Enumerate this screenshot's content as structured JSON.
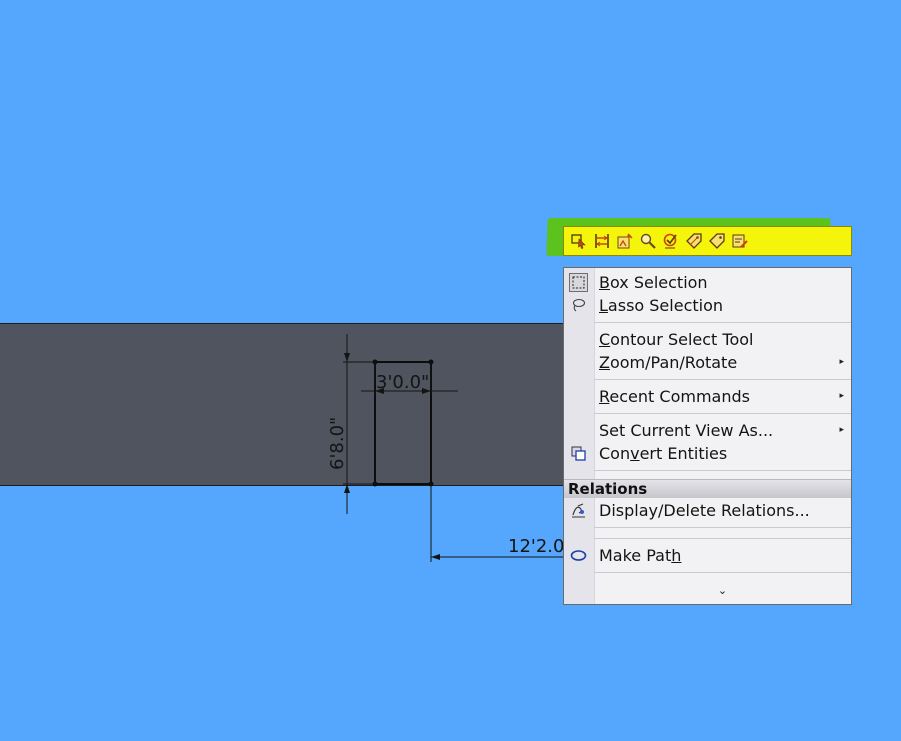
{
  "drawing": {
    "dim_width": "3'0.0\"",
    "dim_height": "6'8.0\"",
    "dim_offset": "12'2.0"
  },
  "toolbar": {
    "buttons": [
      {
        "icon": "select-icon"
      },
      {
        "icon": "trim-icon"
      },
      {
        "icon": "sketch-picture-icon"
      },
      {
        "icon": "zoom-icon"
      },
      {
        "icon": "relation-icon"
      },
      {
        "icon": "tag-icon"
      },
      {
        "icon": "tag-alt-icon"
      },
      {
        "icon": "edit-sketch-icon"
      }
    ],
    "highlight_color": "#5cc21e",
    "background_color": "#f5f50c"
  },
  "menu": {
    "items": {
      "box_selection": {
        "pre": "",
        "key": "B",
        "post": "ox Selection"
      },
      "lasso_selection": {
        "pre": "",
        "key": "L",
        "post": "asso Selection"
      },
      "contour_select": {
        "pre": "",
        "key": "C",
        "post": "ontour Select Tool"
      },
      "zoom_pan_rotate": {
        "pre": "",
        "key": "Z",
        "post": "oom/Pan/Rotate"
      },
      "recent_commands": {
        "pre": "",
        "key": "R",
        "post": "ecent Commands"
      },
      "set_view": {
        "label": "Set Current View As..."
      },
      "convert_entities": {
        "pre": "Con",
        "key": "v",
        "post": "ert Entities"
      },
      "display_relations": {
        "label": "Display/Delete Relations..."
      },
      "make_path": {
        "pre": "Make Pat",
        "key": "h",
        "post": ""
      }
    },
    "relations_header": "Relations",
    "more_glyph": "⌄",
    "submenu_arrow": "▸"
  },
  "colors": {
    "viewport_background": "#55a6fd",
    "wall_fill": "#50545e"
  }
}
